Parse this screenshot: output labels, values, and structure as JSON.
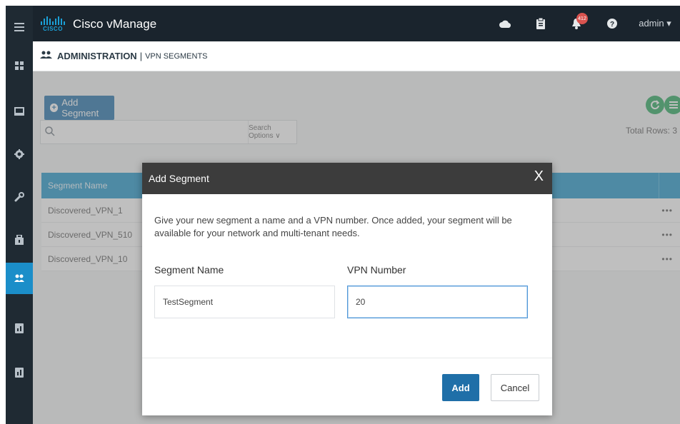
{
  "topbar": {
    "logo_text": "CISCO",
    "app_title": "Cisco vManage",
    "icons": [
      "cloud-icon",
      "clipboard-icon",
      "bell-icon",
      "help-icon"
    ],
    "alarm_count": "412",
    "user": "admin ▾"
  },
  "sidebar": {
    "items": [
      {
        "icon": "menu-icon"
      },
      {
        "icon": "dashboard-icon"
      },
      {
        "icon": "monitor-icon"
      },
      {
        "icon": "configuration-icon"
      },
      {
        "icon": "tools-icon"
      },
      {
        "icon": "maintenance-icon"
      },
      {
        "icon": "administration-icon",
        "active": true
      },
      {
        "icon": "vanalytics-icon"
      },
      {
        "icon": "analytics-icon"
      }
    ]
  },
  "breadcrumb": {
    "section": "ADMINISTRATION",
    "separator": "|",
    "page": "VPN SEGMENTS"
  },
  "toolbar": {
    "add_segment_label": "Add Segment",
    "search_placeholder": "",
    "search_options_label": "Search Options ∨",
    "total_rows": "Total Rows: 3"
  },
  "table": {
    "columns": [
      "Segment Name"
    ],
    "rows": [
      {
        "segment_name": "Discovered_VPN_1",
        "actions": "•••"
      },
      {
        "segment_name": "Discovered_VPN_510",
        "actions": "•••"
      },
      {
        "segment_name": "Discovered_VPN_10",
        "actions": "•••"
      }
    ]
  },
  "modal": {
    "title": "Add Segment",
    "close": "X",
    "description": "Give your new segment a name and a VPN number. Once added, your segment will be available for your network and multi-tenant needs.",
    "segment_name_label": "Segment Name",
    "segment_name_value": "TestSegment",
    "vpn_number_label": "VPN Number",
    "vpn_number_value": "20",
    "add_label": "Add",
    "cancel_label": "Cancel"
  },
  "colors": {
    "accent": "#1f6fa8",
    "table_header": "#1d95c9",
    "topbar": "#1a242d",
    "sidebar_active": "#1b8ec9",
    "refresh_button": "#24a65a",
    "alarm_badge": "#d9534f"
  }
}
